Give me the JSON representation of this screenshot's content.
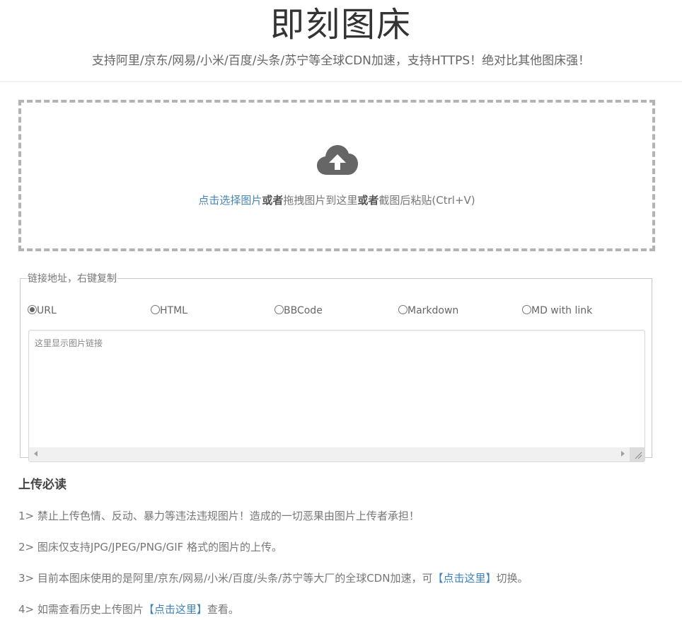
{
  "header": {
    "title": "即刻图床",
    "subtitle": "支持阿里/京东/网易/小米/百度/头条/苏宁等全球CDN加速，支持HTTPS！绝对比其他图床强！"
  },
  "dropzone": {
    "icon": "cloud-upload-icon",
    "select_link": "点击选择图片",
    "or1": "或者",
    "drag_text": "拖拽图片到这里",
    "or2": "或者",
    "paste_text": "截图后粘贴(Ctrl+V)"
  },
  "links": {
    "legend": "链接地址，右键复制",
    "formats": [
      {
        "label": "URL",
        "checked": true
      },
      {
        "label": "HTML",
        "checked": false
      },
      {
        "label": "BBCode",
        "checked": false
      },
      {
        "label": "Markdown",
        "checked": false
      },
      {
        "label": "MD with link",
        "checked": false
      }
    ],
    "placeholder": "这里显示图片链接"
  },
  "notice": {
    "title": "上传必读",
    "items": [
      {
        "text": "1> 禁止上传色情、反动、暴力等违法违规图片！造成的一切恶果由图片上传者承担！"
      },
      {
        "text": "2> 图床仅支持JPG/JPEG/PNG/GIF 格式的图片的上传。"
      },
      {
        "text": "3> 目前本图床使用的是阿里/京东/网易/小米/百度/头条/苏宁等大厂的全球CDN加速，可",
        "link": "【点击这里】",
        "after": "切换。"
      },
      {
        "text": "4> 如需查看历史上传图片",
        "link": "【点击这里】",
        "after": "查看。"
      }
    ]
  },
  "colors": {
    "link": "#4a86b4",
    "border_dashed": "#b3b3b3",
    "icon": "#666666"
  }
}
